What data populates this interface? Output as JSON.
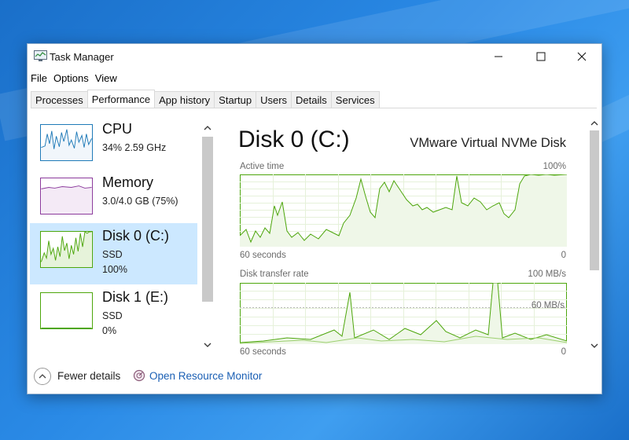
{
  "window": {
    "title": "Task Manager"
  },
  "menu": [
    "File",
    "Options",
    "View"
  ],
  "tabs": [
    "Processes",
    "Performance",
    "App history",
    "Startup",
    "Users",
    "Details",
    "Services"
  ],
  "active_tab": "Performance",
  "sidebar": [
    {
      "name": "CPU",
      "line1": "34%  2.59 GHz",
      "line2": ""
    },
    {
      "name": "Memory",
      "line1": "3.0/4.0 GB (75%)",
      "line2": ""
    },
    {
      "name": "Disk 0 (C:)",
      "line1": "SSD",
      "line2": "100%"
    },
    {
      "name": "Disk 1 (E:)",
      "line1": "SSD",
      "line2": "0%"
    }
  ],
  "main": {
    "title": "Disk 0 (C:)",
    "model": "VMware Virtual NVMe Disk",
    "active_time": {
      "label": "Active time",
      "max": "100%",
      "time": "60 seconds",
      "min": "0"
    },
    "transfer_rate": {
      "label": "Disk transfer rate",
      "max": "100 MB/s",
      "mark": "60 MB/s",
      "time": "60 seconds",
      "min": "0"
    }
  },
  "footer": {
    "fewer_details": "Fewer details",
    "resource_monitor": "Open Resource Monitor"
  },
  "colors": {
    "disk_green": "#4da60c",
    "disk_fill": "#eff7e8",
    "cpu_blue": "#1f7ab8",
    "memory_purple": "#8b3a9c",
    "selection": "#cce8ff",
    "link": "#1a5fb4"
  }
}
